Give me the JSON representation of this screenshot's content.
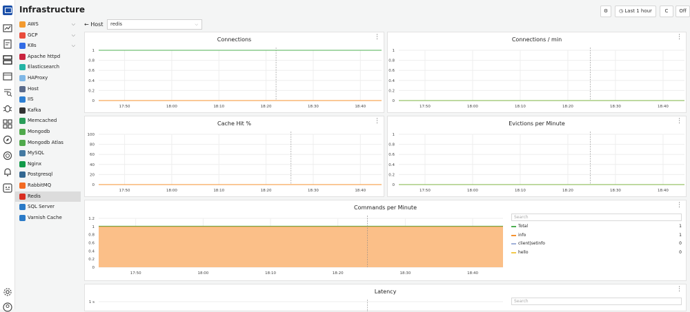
{
  "app": {
    "title": "Infrastructure"
  },
  "toolbar": {
    "time_range": "Last 1 hour",
    "refresh_icon": "C",
    "auto_refresh": "Off"
  },
  "host": {
    "label": "Host",
    "value": "redis"
  },
  "sidebar": {
    "items": [
      {
        "label": "AWS",
        "icon": "aws-icon",
        "color": "#f39a2e",
        "chevron": true
      },
      {
        "label": "GCP",
        "icon": "gcp-icon",
        "color": "#e94c3c",
        "chevron": true
      },
      {
        "label": "K8s",
        "icon": "k8s-icon",
        "color": "#326ce5",
        "chevron": true
      },
      {
        "label": "Apache httpd",
        "icon": "apache-icon",
        "color": "#c9243f"
      },
      {
        "label": "Elasticsearch",
        "icon": "elasticsearch-icon",
        "color": "#24b5a6"
      },
      {
        "label": "HAProxy",
        "icon": "haproxy-icon",
        "color": "#7fb7e6"
      },
      {
        "label": "Host",
        "icon": "host-icon",
        "color": "#5a6b8c"
      },
      {
        "label": "IIS",
        "icon": "iis-icon",
        "color": "#2d7fd3"
      },
      {
        "label": "Kafka",
        "icon": "kafka-icon",
        "color": "#333333"
      },
      {
        "label": "Memcached",
        "icon": "memcached-icon",
        "color": "#2a9d59"
      },
      {
        "label": "Mongodb",
        "icon": "mongodb-icon",
        "color": "#4fa94b"
      },
      {
        "label": "Mongodb Atlas",
        "icon": "mongodb-atlas-icon",
        "color": "#4fa94b"
      },
      {
        "label": "MySQL",
        "icon": "mysql-icon",
        "color": "#4479a1"
      },
      {
        "label": "Nginx",
        "icon": "nginx-icon",
        "color": "#119a49"
      },
      {
        "label": "Postgresql",
        "icon": "postgresql-icon",
        "color": "#336791"
      },
      {
        "label": "RabbitMQ",
        "icon": "rabbitmq-icon",
        "color": "#f26a22"
      },
      {
        "label": "Redis",
        "icon": "redis-icon",
        "color": "#d82c20",
        "selected": true
      },
      {
        "label": "SQL Server",
        "icon": "sql-server-icon",
        "color": "#2a7ac7"
      },
      {
        "label": "Varnish Cache",
        "icon": "varnish-icon",
        "color": "#2a7ac7"
      }
    ]
  },
  "panels": {
    "connections": {
      "title": "Connections"
    },
    "connections_per_min": {
      "title": "Connections / min"
    },
    "cache_hit": {
      "title": "Cache Hit %"
    },
    "evictions": {
      "title": "Evictions per Minute"
    },
    "commands": {
      "title": "Commands per Minute",
      "search_placeholder": "Search"
    },
    "latency": {
      "title": "Latency",
      "search_placeholder": "Search"
    }
  },
  "chart_data": [
    {
      "type": "line",
      "title": "Connections",
      "x": [
        "17:50",
        "18:00",
        "18:10",
        "18:20",
        "18:30",
        "18:40"
      ],
      "y_ticks": [
        "0",
        "0.2",
        "0.4",
        "0.6",
        "0.8",
        "1"
      ],
      "ylim": [
        0,
        1
      ],
      "series": [
        {
          "color": "#4caf50",
          "values": [
            1,
            1,
            1,
            1,
            1,
            1
          ]
        },
        {
          "color": "#f5922e",
          "values": [
            0,
            0,
            0,
            0,
            0,
            0
          ]
        }
      ]
    },
    {
      "type": "line",
      "title": "Connections / min",
      "x": [
        "17:50",
        "18:00",
        "18:10",
        "18:20",
        "18:30",
        "18:40"
      ],
      "y_ticks": [
        "0",
        "0.2",
        "0.4",
        "0.6",
        "0.8",
        "1"
      ],
      "ylim": [
        0,
        1
      ],
      "series": [
        {
          "color": "#7cb342",
          "values": [
            0,
            0,
            0,
            0,
            0,
            0
          ]
        }
      ]
    },
    {
      "type": "line",
      "title": "Cache Hit %",
      "x": [
        "17:50",
        "18:00",
        "18:10",
        "18:20",
        "18:30",
        "18:40"
      ],
      "y_ticks": [
        "0",
        "20",
        "40",
        "60",
        "80",
        "100"
      ],
      "ylim": [
        0,
        100
      ],
      "series": [
        {
          "color": "#f5922e",
          "values": [
            0,
            0,
            0,
            0,
            0,
            0
          ]
        }
      ]
    },
    {
      "type": "line",
      "title": "Evictions per Minute",
      "x": [
        "17:50",
        "18:00",
        "18:10",
        "18:20",
        "18:30",
        "18:40"
      ],
      "y_ticks": [
        "0",
        "0.2",
        "0.4",
        "0.6",
        "0.8",
        "1"
      ],
      "ylim": [
        0,
        1
      ],
      "series": [
        {
          "color": "#7cb342",
          "values": [
            0,
            0,
            0,
            0,
            0,
            0
          ]
        }
      ]
    },
    {
      "type": "area",
      "title": "Commands per Minute",
      "x": [
        "17:50",
        "18:00",
        "18:10",
        "18:20",
        "18:30",
        "18:40"
      ],
      "y_ticks": [
        "0",
        "0.2",
        "0.4",
        "0.6",
        "0.8",
        "1",
        "1.2"
      ],
      "ylim": [
        0,
        1.2
      ],
      "series": [
        {
          "name": "Total",
          "color": "#4caf50",
          "value": "1"
        },
        {
          "name": "info",
          "color": "#f5922e",
          "value": "1"
        },
        {
          "name": "client|setinfo",
          "color": "#9fb0d8",
          "value": "0"
        },
        {
          "name": "hello",
          "color": "#f2c84b",
          "value": "0"
        }
      ]
    },
    {
      "type": "line",
      "title": "Latency",
      "y_ticks": [
        "1 s"
      ],
      "series": []
    }
  ]
}
